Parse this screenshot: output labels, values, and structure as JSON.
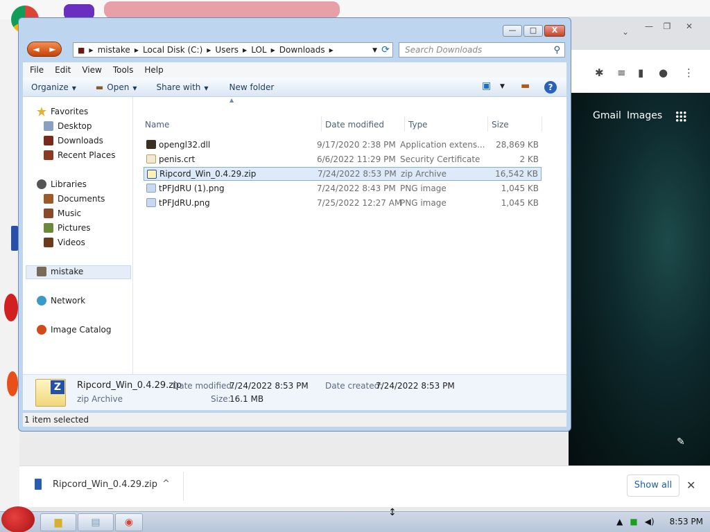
{
  "explorer": {
    "window_controls": {
      "minimize": "—",
      "maximize": "□",
      "close": "X"
    },
    "nav": {
      "back": "◄",
      "forward": "►"
    },
    "breadcrumb": [
      "mistake",
      "Local Disk (C:)",
      "Users",
      "LOL",
      "Downloads"
    ],
    "search_placeholder": "Search Downloads",
    "menu": [
      "File",
      "Edit",
      "View",
      "Tools",
      "Help"
    ],
    "commands": {
      "organize": "Organize",
      "open": "Open",
      "share_with": "Share with",
      "new_folder": "New folder",
      "help": "?"
    },
    "nav_pane": {
      "favorites": "Favorites",
      "desktop": "Desktop",
      "downloads": "Downloads",
      "recent_places": "Recent Places",
      "libraries": "Libraries",
      "documents": "Documents",
      "music": "Music",
      "pictures": "Pictures",
      "videos": "Videos",
      "mistake": "mistake",
      "network": "Network",
      "image_catalog": "Image Catalog"
    },
    "columns": {
      "name": "Name",
      "date": "Date modified",
      "type": "Type",
      "size": "Size"
    },
    "files": [
      {
        "name": "opengl32.dll",
        "date": "9/17/2020 2:38 PM",
        "type": "Application extens...",
        "size": "28,869 KB"
      },
      {
        "name": "penis.crt",
        "date": "6/6/2022 11:29 PM",
        "type": "Security Certificate",
        "size": "2 KB"
      },
      {
        "name": "Ripcord_Win_0.4.29.zip",
        "date": "7/24/2022 8:53 PM",
        "type": "zip Archive",
        "size": "16,542 KB"
      },
      {
        "name": "tPFJdRU (1).png",
        "date": "7/24/2022 8:43 PM",
        "type": "PNG image",
        "size": "1,045 KB"
      },
      {
        "name": "tPFJdRU.png",
        "date": "7/25/2022 12:27 AM",
        "type": "PNG image",
        "size": "1,045 KB"
      }
    ],
    "details": {
      "filename": "Ripcord_Win_0.4.29.zip",
      "filetype": "zip Archive",
      "date_modified_label": "Date modified:",
      "date_modified": "7/24/2022 8:53 PM",
      "date_created_label": "Date created:",
      "date_created": "7/24/2022 8:53 PM",
      "size_label": "Size:",
      "size": "16.1 MB",
      "icon_letter": "Z"
    },
    "status": "1 item selected"
  },
  "chrome": {
    "gmail": "Gmail",
    "images": "Images"
  },
  "downloads_bar": {
    "filename": "Ripcord_Win_0.4.29.zip",
    "show_all": "Show all",
    "close": "✕"
  },
  "taskbar": {
    "clock": "8:53 PM"
  },
  "colors": {
    "selection": "#dceaf9",
    "accent": "#1a5fb4"
  }
}
